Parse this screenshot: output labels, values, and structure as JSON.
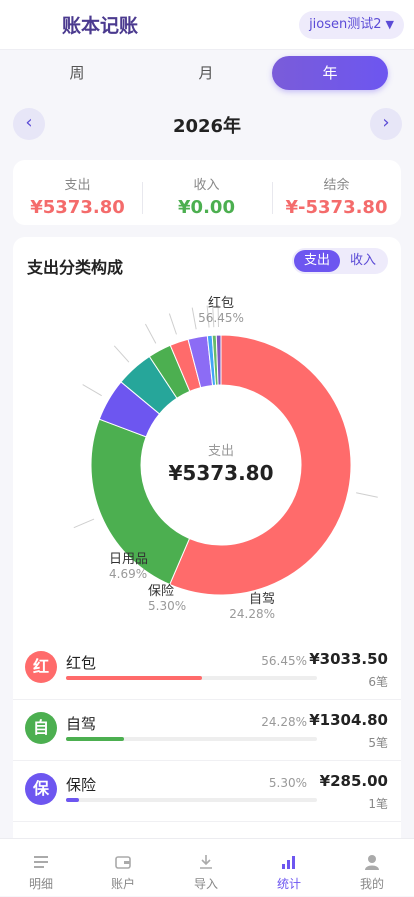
{
  "header": {
    "title": "账本记账",
    "user_label": "jiosen测试2",
    "user_dropdown_icon": "▼"
  },
  "period_tabs": [
    {
      "label": "周",
      "active": false
    },
    {
      "label": "月",
      "active": false
    },
    {
      "label": "年",
      "active": true
    }
  ],
  "year_nav": {
    "prev_icon": "‹",
    "next_icon": "›",
    "label": "2026年"
  },
  "summary": {
    "expense_label": "支出",
    "expense_value": "¥5373.80",
    "expense_color": "#f46b6b",
    "income_label": "收入",
    "income_value": "¥0.00",
    "income_color": "#4caf50",
    "balance_label": "结余",
    "balance_value": "¥-5373.80",
    "balance_color": "#f46b6b"
  },
  "chart_section": {
    "title": "支出分类构成",
    "toggle_expense": "支出",
    "toggle_income": "收入",
    "center_label": "支出",
    "center_value": "¥5373.80"
  },
  "chart_data": {
    "type": "pie",
    "title": "支出分类构成",
    "slices": [
      {
        "name": "红包",
        "value": 56.45,
        "pct_label": "56.45%",
        "color": "#ff6b6b",
        "show_label": true
      },
      {
        "name": "自驾",
        "value": 24.28,
        "pct_label": "24.28%",
        "color": "#4caf50",
        "show_label": true
      },
      {
        "name": "保险",
        "value": 5.3,
        "pct_label": "5.30%",
        "color": "#6d56f0",
        "show_label": true
      },
      {
        "name": "日用品",
        "value": 4.69,
        "pct_label": "4.69%",
        "color": "#26a69a",
        "show_label": true
      },
      {
        "name": "",
        "value": 2.9,
        "pct_label": "",
        "color": "#4caf50",
        "show_label": false
      },
      {
        "name": "",
        "value": 2.3,
        "pct_label": "",
        "color": "#ff6b6b",
        "show_label": false
      },
      {
        "name": "",
        "value": 2.4,
        "pct_label": "",
        "color": "#8c6cf5",
        "show_label": false
      },
      {
        "name": "",
        "value": 0.6,
        "pct_label": "",
        "color": "#42a5f5",
        "show_label": false
      },
      {
        "name": "",
        "value": 0.5,
        "pct_label": "",
        "color": "#66bb6a",
        "show_label": false
      },
      {
        "name": "",
        "value": 0.58,
        "pct_label": "",
        "color": "#7e57c2",
        "show_label": false
      }
    ]
  },
  "categories": [
    {
      "icon_char": "红",
      "color": "#ff6b6b",
      "name": "红包",
      "pct": "56.45%",
      "fraction": 0.5645,
      "amount": "¥3033.50",
      "count": "6笔"
    },
    {
      "icon_char": "自",
      "color": "#4caf50",
      "name": "自驾",
      "pct": "24.28%",
      "fraction": 0.2428,
      "amount": "¥1304.80",
      "count": "5笔"
    },
    {
      "icon_char": "保",
      "color": "#6d56f0",
      "name": "保险",
      "pct": "5.30%",
      "fraction": 0.053,
      "amount": "¥285.00",
      "count": "1笔"
    }
  ],
  "tabbar": [
    {
      "label": "明细",
      "icon": "list-icon",
      "active": false
    },
    {
      "label": "账户",
      "icon": "wallet-icon",
      "active": false
    },
    {
      "label": "导入",
      "icon": "download-icon",
      "active": false
    },
    {
      "label": "统计",
      "icon": "bar-chart-icon",
      "active": true
    },
    {
      "label": "我的",
      "icon": "user-icon",
      "active": false
    }
  ]
}
